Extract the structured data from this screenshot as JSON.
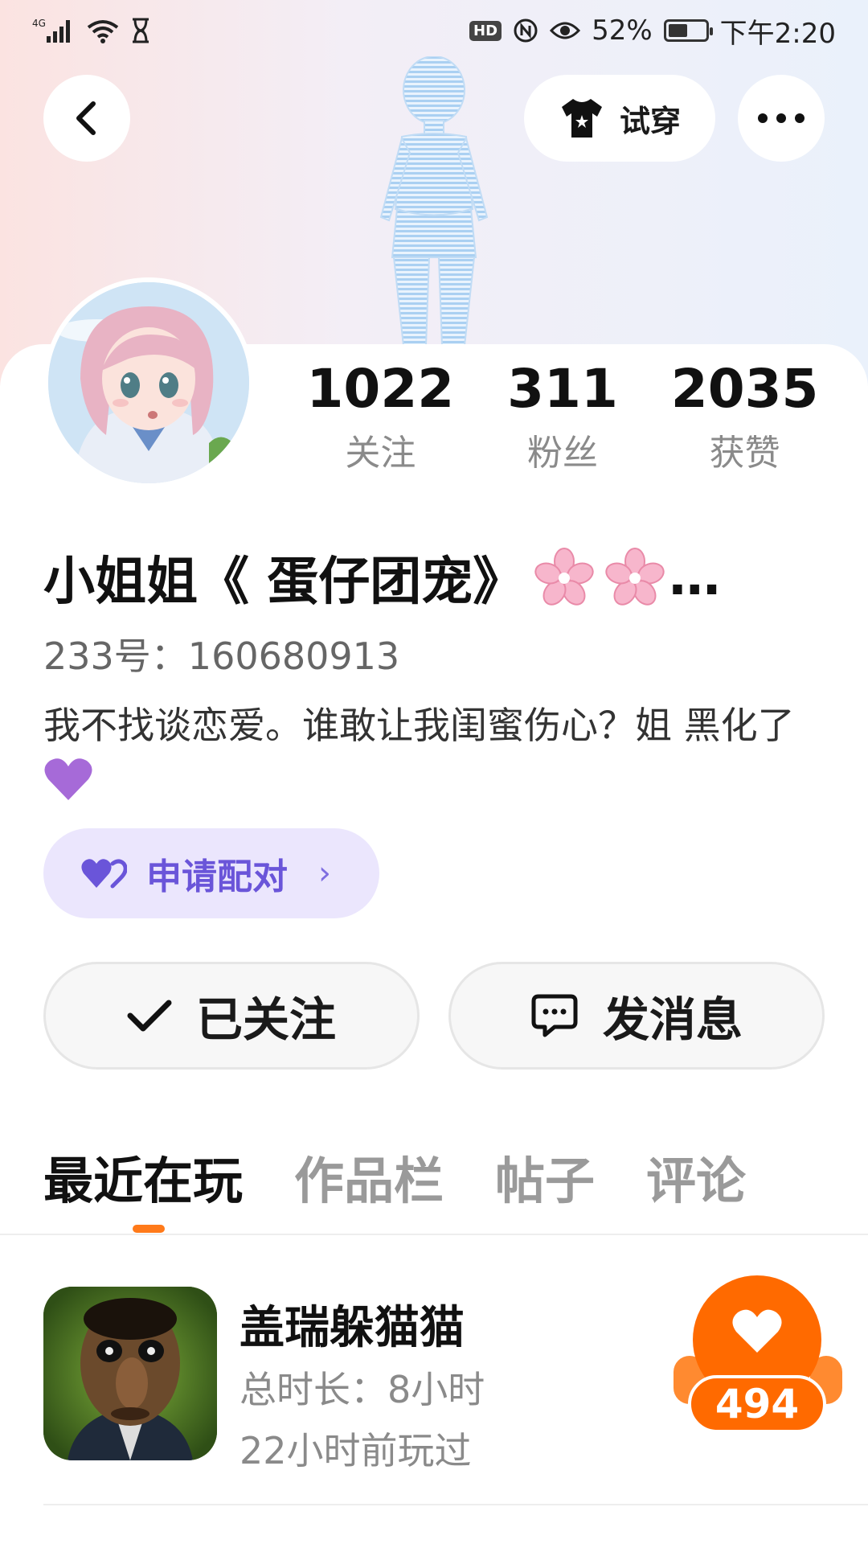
{
  "status_bar": {
    "network": "4G",
    "hd": "HD",
    "battery_percent": "52%",
    "battery_level": 0.52,
    "time": "下午2:20"
  },
  "header": {
    "tryon_label": "试穿",
    "back_icon": "chevron-left-icon",
    "more_icon": "more-horizontal-icon"
  },
  "profile": {
    "stats": [
      {
        "value": "1022",
        "label": "关注"
      },
      {
        "value": "311",
        "label": "粉丝"
      },
      {
        "value": "2035",
        "label": "获赞"
      }
    ],
    "nickname": "小姐姐《 蛋仔团宠》",
    "nickname_ellipsis": "…",
    "uid": "233号：160680913",
    "bio": "我不找谈恋爱。谁敢让我闺蜜伤心？姐 黑化了",
    "pair_label": "申请配对",
    "pair_chevron": "›",
    "follow_label": "已关注",
    "message_label": "发消息"
  },
  "tabs": [
    {
      "label": "最近在玩",
      "active": true
    },
    {
      "label": "作品栏",
      "active": false
    },
    {
      "label": "帖子",
      "active": false
    },
    {
      "label": "评论",
      "active": false
    }
  ],
  "games": [
    {
      "title": "盖瑞躲猫猫",
      "duration": "总时长：8小时",
      "last_played": "22小时前玩过",
      "likes": "494"
    }
  ],
  "colors": {
    "accent_orange": "#ff6a00",
    "pair_purple": "#6a55d9",
    "pair_bg": "#ebe6fd"
  }
}
